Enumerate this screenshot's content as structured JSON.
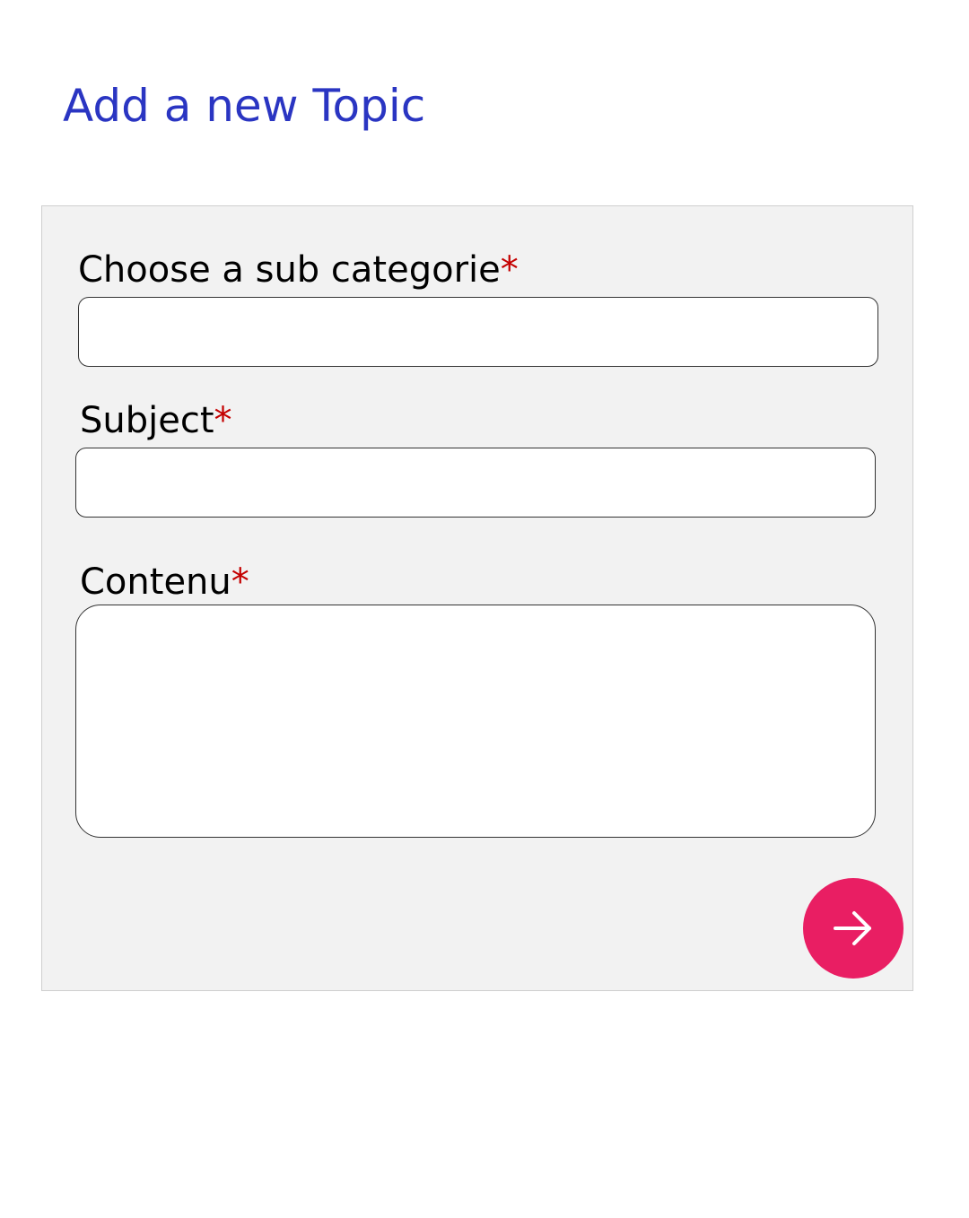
{
  "page": {
    "title": "Add a new Topic"
  },
  "form": {
    "subcategory": {
      "label": "Choose a sub categorie",
      "required_marker": "*",
      "value": ""
    },
    "subject": {
      "label": "Subject",
      "required_marker": "*",
      "value": ""
    },
    "content": {
      "label": "Contenu",
      "required_marker": "*",
      "value": ""
    },
    "submit": {
      "icon": "arrow-right-icon"
    }
  },
  "colors": {
    "title": "#2a35c2",
    "required": "#c40000",
    "panel_background": "#f2f2f2",
    "submit_background": "#e91e63",
    "submit_icon": "#ffffff"
  }
}
